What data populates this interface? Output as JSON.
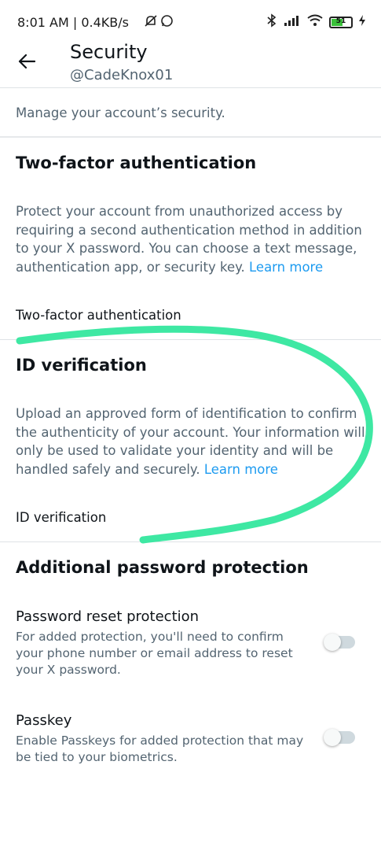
{
  "status_bar": {
    "left_text": "8:01 AM | 0.4KB/s",
    "battery": "51",
    "icons": [
      "mute-icon",
      "whatsapp-icon",
      "bluetooth-icon",
      "signal-icon",
      "wifi-icon",
      "battery-icon",
      "charging-icon"
    ]
  },
  "header": {
    "title": "Security",
    "handle": "@CadeKnox01",
    "back_icon": "back-arrow-icon"
  },
  "intro": "Manage your account’s security.",
  "two_factor": {
    "heading": "Two-factor authentication",
    "description": "Protect your account from unauthorized access by requiring a second authentication method in addition to your X password. You can choose a text message, authentication app, or security key.",
    "learn_more": "Learn more",
    "item_label": "Two-factor authentication"
  },
  "id_verification": {
    "heading": "ID verification",
    "description": "Upload an approved form of identification to confirm the authenticity of your account. Your information will only be used to validate your identity and will be handled safely and securely.",
    "learn_more": "Learn more",
    "item_label": "ID verification"
  },
  "password_protection": {
    "heading": "Additional password protection",
    "options": [
      {
        "title": "Password reset protection",
        "description": "For added protection, you'll need to confirm your phone number or email address to reset your X password.",
        "enabled": false
      },
      {
        "title": "Passkey",
        "description": "Enable Passkeys for added protection that may be tied to your biometrics.",
        "enabled": false
      }
    ]
  },
  "colors": {
    "link": "#1d9bf0",
    "scribble": "#3ee8a3",
    "secondary_text": "#536471"
  }
}
